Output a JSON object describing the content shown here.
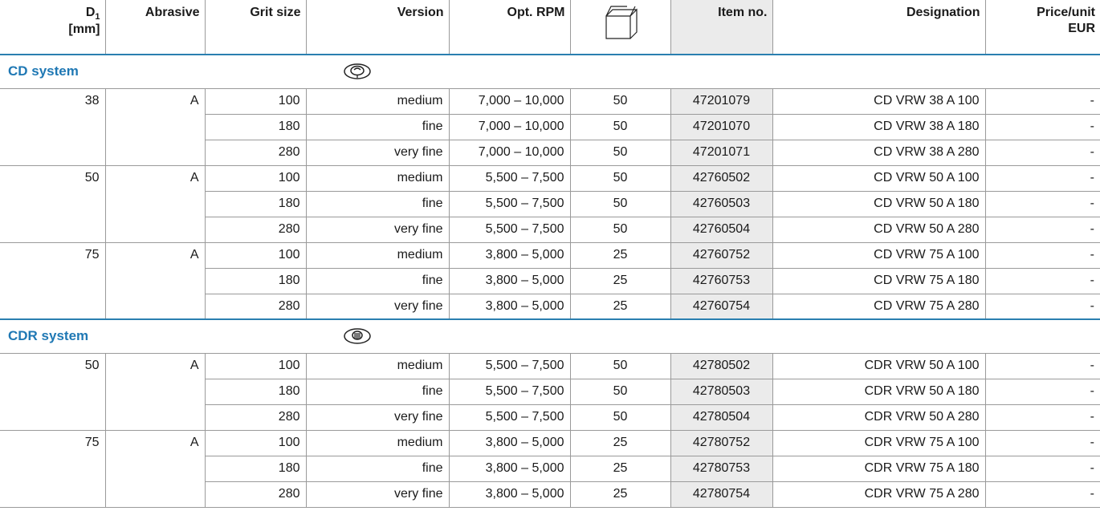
{
  "headers": {
    "d1_main": "D",
    "d1_sub": "1",
    "d1_unit": "[mm]",
    "abrasive": "Abrasive",
    "grit": "Grit size",
    "version": "Version",
    "rpm": "Opt. RPM",
    "package_icon": "package-box-icon",
    "item": "Item no.",
    "designation": "Designation",
    "price_line1": "Price/unit",
    "price_line2": "EUR"
  },
  "sections": [
    {
      "title": "CD system",
      "icon": "cd-system-icon",
      "rows": [
        {
          "d1": "38",
          "abrasive": "A",
          "grit": "100",
          "version": "medium",
          "rpm": "7,000 – 10,000",
          "pack": "50",
          "item": "47201079",
          "designation": "CD VRW 38 A 100",
          "price": "-"
        },
        {
          "d1": "",
          "abrasive": "",
          "grit": "180",
          "version": "fine",
          "rpm": "7,000 – 10,000",
          "pack": "50",
          "item": "47201070",
          "designation": "CD VRW 38 A 180",
          "price": "-"
        },
        {
          "d1": "",
          "abrasive": "",
          "grit": "280",
          "version": "very fine",
          "rpm": "7,000 – 10,000",
          "pack": "50",
          "item": "47201071",
          "designation": "CD VRW 38 A 280",
          "price": "-"
        },
        {
          "d1": "50",
          "abrasive": "A",
          "grit": "100",
          "version": "medium",
          "rpm": "5,500 – 7,500",
          "pack": "50",
          "item": "42760502",
          "designation": "CD VRW 50 A 100",
          "price": "-"
        },
        {
          "d1": "",
          "abrasive": "",
          "grit": "180",
          "version": "fine",
          "rpm": "5,500 – 7,500",
          "pack": "50",
          "item": "42760503",
          "designation": "CD VRW 50 A 180",
          "price": "-"
        },
        {
          "d1": "",
          "abrasive": "",
          "grit": "280",
          "version": "very fine",
          "rpm": "5,500 – 7,500",
          "pack": "50",
          "item": "42760504",
          "designation": "CD VRW 50 A 280",
          "price": "-"
        },
        {
          "d1": "75",
          "abrasive": "A",
          "grit": "100",
          "version": "medium",
          "rpm": "3,800 – 5,000",
          "pack": "25",
          "item": "42760752",
          "designation": "CD VRW 75 A 100",
          "price": "-"
        },
        {
          "d1": "",
          "abrasive": "",
          "grit": "180",
          "version": "fine",
          "rpm": "3,800 – 5,000",
          "pack": "25",
          "item": "42760753",
          "designation": "CD VRW 75 A 180",
          "price": "-"
        },
        {
          "d1": "",
          "abrasive": "",
          "grit": "280",
          "version": "very fine",
          "rpm": "3,800 – 5,000",
          "pack": "25",
          "item": "42760754",
          "designation": "CD VRW 75 A 280",
          "price": "-"
        }
      ]
    },
    {
      "title": "CDR system",
      "icon": "cdr-system-icon",
      "rows": [
        {
          "d1": "50",
          "abrasive": "A",
          "grit": "100",
          "version": "medium",
          "rpm": "5,500 – 7,500",
          "pack": "50",
          "item": "42780502",
          "designation": "CDR VRW 50 A 100",
          "price": "-"
        },
        {
          "d1": "",
          "abrasive": "",
          "grit": "180",
          "version": "fine",
          "rpm": "5,500 – 7,500",
          "pack": "50",
          "item": "42780503",
          "designation": "CDR VRW 50 A 180",
          "price": "-"
        },
        {
          "d1": "",
          "abrasive": "",
          "grit": "280",
          "version": "very fine",
          "rpm": "5,500 – 7,500",
          "pack": "50",
          "item": "42780504",
          "designation": "CDR VRW 50 A 280",
          "price": "-"
        },
        {
          "d1": "75",
          "abrasive": "A",
          "grit": "100",
          "version": "medium",
          "rpm": "3,800 – 5,000",
          "pack": "25",
          "item": "42780752",
          "designation": "CDR VRW 75 A 100",
          "price": "-"
        },
        {
          "d1": "",
          "abrasive": "",
          "grit": "180",
          "version": "fine",
          "rpm": "3,800 – 5,000",
          "pack": "25",
          "item": "42780753",
          "designation": "CDR VRW 75 A 180",
          "price": "-"
        },
        {
          "d1": "",
          "abrasive": "",
          "grit": "280",
          "version": "very fine",
          "rpm": "3,800 – 5,000",
          "pack": "25",
          "item": "42780754",
          "designation": "CDR VRW 75 A 280",
          "price": "-"
        }
      ]
    }
  ],
  "colors": {
    "section_title": "#1f78b4",
    "accent_rule": "#2a7fb0",
    "item_column_bg": "#ebebeb"
  }
}
